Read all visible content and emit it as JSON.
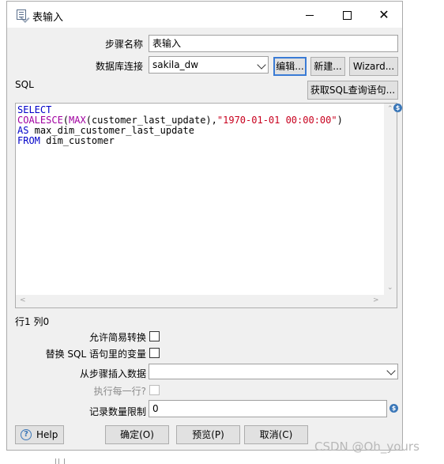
{
  "window": {
    "title": "表输入",
    "minimize_label": "minimize",
    "maximize_label": "maximize",
    "close_label": "close"
  },
  "form": {
    "step_name_label": "步骤名称",
    "step_name_value": "表输入",
    "connection_label": "数据库连接",
    "connection_value": "sakila_dw",
    "edit_button": "编辑...",
    "new_button": "新建...",
    "wizard_button": "Wizard...",
    "sql_label": "SQL",
    "get_sql_button": "获取SQL查询语句..."
  },
  "sql": {
    "line1": "SELECT",
    "line2_fn1": "COALESCE",
    "line2_p1": "(",
    "line2_fn2": "MAX",
    "line2_p2": "(customer_last_update),",
    "line2_str": "\"1970-01-01 00:00:00\"",
    "line2_p3": ")",
    "line3_kw": "AS",
    "line3_rest": " max_dim_customer_last_update",
    "line4_kw": "FROM",
    "line4_rest": " dim_customer"
  },
  "status": {
    "position": "行1 列0"
  },
  "options": {
    "lazy_conversion_label": "允许简易转换",
    "lazy_conversion_checked": false,
    "replace_vars_label": "替换 SQL 语句里的变量",
    "replace_vars_checked": false,
    "insert_from_step_label": "从步骤插入数据",
    "insert_from_step_value": "",
    "execute_each_row_label": "执行每一行?",
    "execute_each_row_checked": false,
    "limit_label": "记录数量限制",
    "limit_value": "0"
  },
  "buttons": {
    "help": "Help",
    "ok": "确定(O)",
    "preview": "预览(P)",
    "cancel": "取消(C)"
  },
  "watermark": "CSDN @Oh_yours"
}
